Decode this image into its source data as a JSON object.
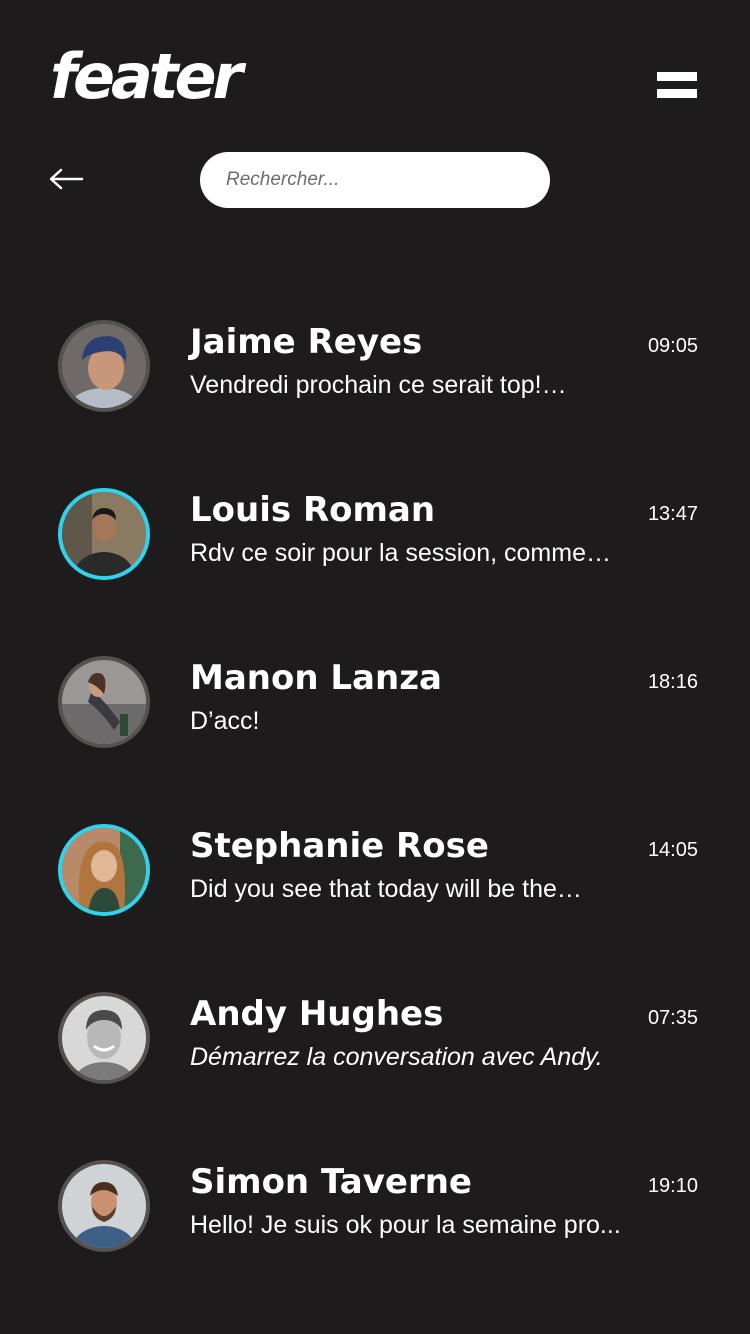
{
  "header": {
    "logo_text": "feater",
    "menu_icon": "hamburger-menu-icon",
    "back_icon": "arrow-left-icon"
  },
  "search": {
    "placeholder": "Rechercher...",
    "value": ""
  },
  "colors": {
    "background": "#1d1b1b",
    "online_ring": "#2fd3ee",
    "offline_ring": "#55514f",
    "text": "#ffffff"
  },
  "conversations": [
    {
      "name": "Jaime Reyes",
      "preview": "Vendredi prochain ce serait top!…",
      "time": "09:05",
      "online": false,
      "preview_italic": false
    },
    {
      "name": "Louis Roman",
      "preview": "Rdv ce soir pour la session, comme…",
      "time": "13:47",
      "online": true,
      "preview_italic": false
    },
    {
      "name": "Manon Lanza",
      "preview": "D’acc!",
      "time": "18:16",
      "online": false,
      "preview_italic": false
    },
    {
      "name": "Stephanie Rose",
      "preview": "Did you see that today will be the…",
      "time": "14:05",
      "online": true,
      "preview_italic": false
    },
    {
      "name": "Andy Hughes",
      "preview": "Démarrez la conversation avec Andy.",
      "time": "07:35",
      "online": false,
      "preview_italic": true
    },
    {
      "name": "Simon Taverne",
      "preview": "Hello! Je suis ok pour la semaine pro...",
      "time": "19:10",
      "online": false,
      "preview_italic": false
    }
  ]
}
